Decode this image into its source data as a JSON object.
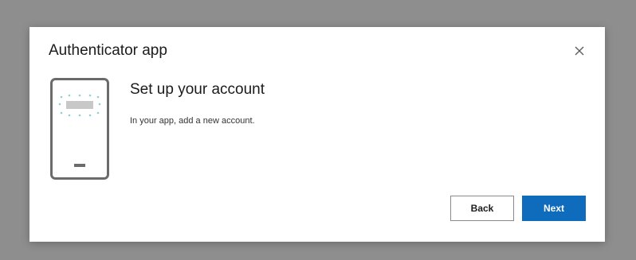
{
  "dialog": {
    "title": "Authenticator app",
    "close_icon": "close-icon",
    "illustration_icon": "phone-qr-icon",
    "heading": "Set up your account",
    "description": "In your app, add a new account.",
    "back_label": "Back",
    "next_label": "Next"
  },
  "colors": {
    "backdrop": "#8e8e8e",
    "accent": "#0f6cbd",
    "phone_frame": "#6b6b6b"
  }
}
